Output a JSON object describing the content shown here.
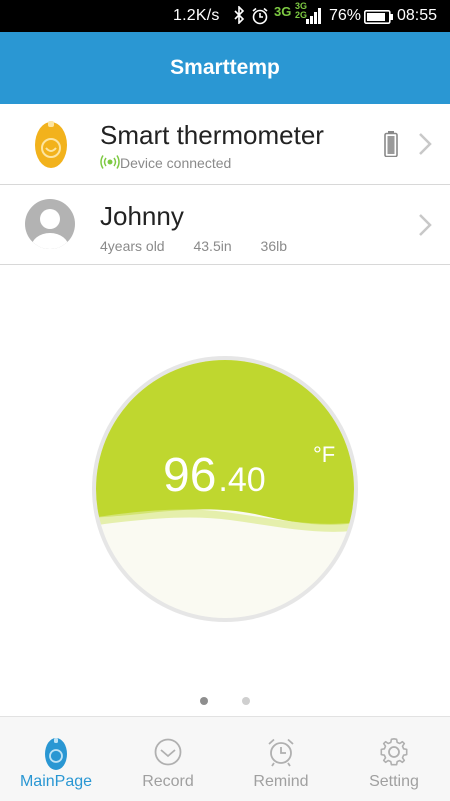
{
  "status_bar": {
    "speed": "1.2K/s",
    "network": "3G",
    "network_sub": [
      "3G",
      "2G"
    ],
    "battery": "76%",
    "time": "08:55"
  },
  "header": {
    "title": "Smarttemp"
  },
  "device": {
    "name": "Smart thermometer",
    "status": "Device connected"
  },
  "profile": {
    "name": "Johnny",
    "age": "4years old",
    "height": "43.5in",
    "weight": "36lb"
  },
  "reading": {
    "whole": "96",
    "decimal": ".40",
    "unit": "°F"
  },
  "pager": {
    "pages": 2,
    "active": 1
  },
  "nav": [
    {
      "label": "MainPage",
      "icon": "thermometer-icon",
      "active": true
    },
    {
      "label": "Record",
      "icon": "clock-icon",
      "active": false
    },
    {
      "label": "Remind",
      "icon": "alarm-clock-icon",
      "active": false
    },
    {
      "label": "Setting",
      "icon": "gear-icon",
      "active": false
    }
  ],
  "colors": {
    "header": "#2a97d3",
    "gauge": "#bfd72f",
    "accent": "#f2b21c",
    "status_green": "#7dc942"
  }
}
